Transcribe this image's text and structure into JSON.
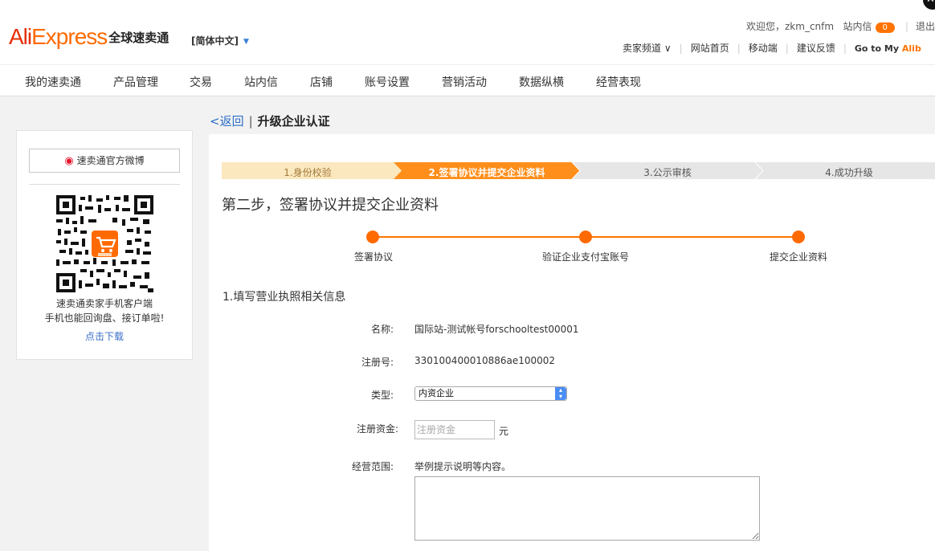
{
  "header": {
    "logo_ali": "Ali",
    "logo_express": "Express",
    "logo_cn": "全球速卖通",
    "language": "[简体中文]",
    "welcome": "欢迎您，zkm_cnfm",
    "inbox_label": "站内信",
    "inbox_count": "0",
    "logout": "退出",
    "links": {
      "seller_channel": "卖家频道",
      "site_home": "网站首页",
      "mobile": "移动端",
      "feedback": "建议反馈",
      "goto_prefix": "Go to My ",
      "goto_brand": "Alib"
    }
  },
  "nav": {
    "items": [
      "我的速卖通",
      "产品管理",
      "交易",
      "站内信",
      "店铺",
      "账号设置",
      "营销活动",
      "数据纵横",
      "经营表现"
    ]
  },
  "sidebar": {
    "weibo": "速卖通官方微博",
    "qr_text1": "速卖通卖家手机客户端",
    "qr_text2": "手机也能回询盘、接订单啦!",
    "download": "点击下载"
  },
  "breadcrumb": {
    "back": "<返回",
    "title": "升级企业认证"
  },
  "steps": [
    {
      "label": "1.身份校验",
      "state": "done"
    },
    {
      "label": "2.签署协议并提交企业资料",
      "state": "active"
    },
    {
      "label": "3.公示审核",
      "state": "todo"
    },
    {
      "label": "4.成功升级",
      "state": "todo"
    }
  ],
  "colors": {
    "accent": "#ff7300",
    "done_bg": "#fce8bf",
    "todo_bg": "#e6e6e6",
    "link": "#2f6fc8"
  },
  "step_title": "第二步，签署协议并提交企业资料",
  "timeline": {
    "labels": [
      "签署协议",
      "验证企业支付宝账号",
      "提交企业资料"
    ]
  },
  "section_title": "1.填写营业执照相关信息",
  "form": {
    "name_label": "名称:",
    "name_value": "国际站-测试帐号forschooltest00001",
    "reg_label": "注册号:",
    "reg_value": "330100400010886ae100002",
    "type_label": "类型:",
    "type_value": "内资企业",
    "capital_label": "注册资金:",
    "capital_placeholder": "注册资金",
    "capital_unit": "元",
    "scope_label": "经营范围:",
    "scope_hint": "举例提示说明等内容。"
  }
}
